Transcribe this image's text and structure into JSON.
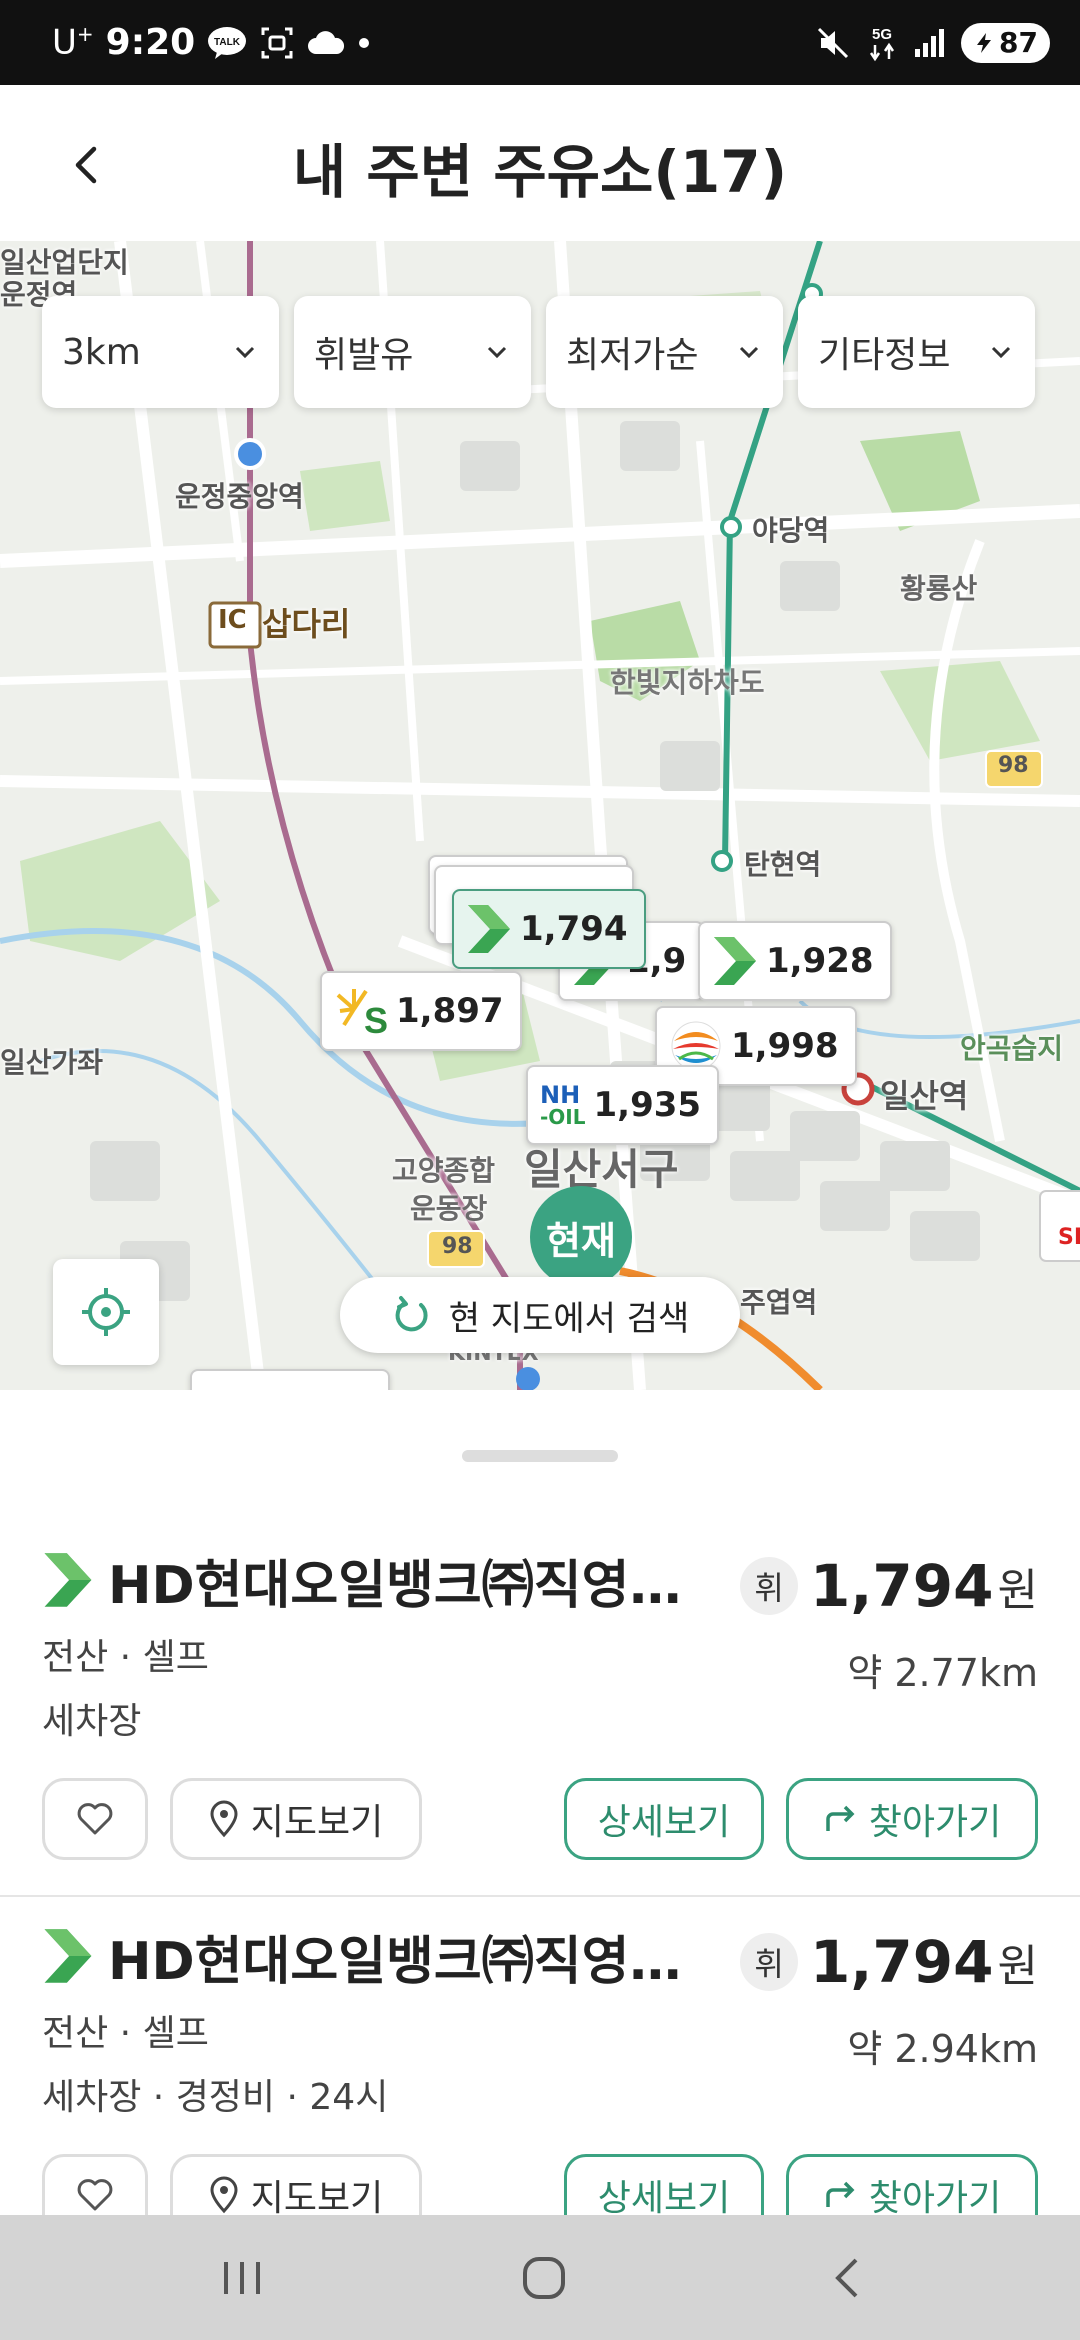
{
  "status_bar": {
    "carrier": "U",
    "carrier_sup": "+",
    "time": "9:20",
    "talk_badge": "TALK",
    "network": "5G",
    "battery": "87"
  },
  "header": {
    "title": "내 주변 주유소(17)"
  },
  "filters": [
    {
      "label": "3km"
    },
    {
      "label": "휘발유"
    },
    {
      "label": "최저가순"
    },
    {
      "label": "기타정보"
    }
  ],
  "map": {
    "labels": {
      "industrial": "일산업단지",
      "station_north": "운정역",
      "woonjeong": "운정중앙역",
      "yadang": "야당역",
      "hwangryongsan": "황룡산",
      "ic": "IC",
      "sapdari": "삽다리",
      "hanbit": "한빛지하차도",
      "route_98": "98",
      "tanhyeon": "탄현역",
      "sangajwa": "일산가좌",
      "angok": "안곡습지",
      "ilsan_station": "일산역",
      "goyang_stadium_1": "고양종합",
      "goyang_stadium_2": "운동장",
      "ilsanseo": "일산서구",
      "juyeop": "주엽역",
      "kintex": "KINTEX",
      "sk": "SK",
      "route_98_b": "98"
    },
    "markers": [
      {
        "brand": "hd-hyundai",
        "price": "1,794",
        "selected": true
      },
      {
        "brand": "s-oil",
        "price": "1,897"
      },
      {
        "brand": "hd-hyundai",
        "price": "1,9"
      },
      {
        "brand": "hd-hyundai",
        "price": "1,928"
      },
      {
        "brand": "gs",
        "price": "1,998"
      },
      {
        "brand": "nh-oil",
        "price": "1,935"
      }
    ],
    "nh_logo_top": "NH",
    "nh_logo_bottom": "-OIL",
    "current_pin": "현재",
    "research_button": "현 지도에서 검색"
  },
  "stations": [
    {
      "name": "HD현대오일뱅크㈜직영…",
      "type": "전산 · 셀프",
      "extras": "세차장",
      "fuel_badge": "휘",
      "price": "1,794",
      "unit": "원",
      "distance": "약 2.77km",
      "map_btn": "지도보기",
      "detail_btn": "상세보기",
      "nav_btn": "찾아가기"
    },
    {
      "name": "HD현대오일뱅크㈜직영…",
      "type": "전산 · 셀프",
      "extras": "세차장 · 경정비 · 24시",
      "fuel_badge": "휘",
      "price": "1,794",
      "unit": "원",
      "distance": "약 2.94km",
      "map_btn": "지도보기",
      "detail_btn": "상세보기",
      "nav_btn": "찾아가기"
    }
  ],
  "colors": {
    "accent": "#3ba382",
    "accent_text": "#2d8c6d",
    "hd_green": "#3aa552"
  }
}
